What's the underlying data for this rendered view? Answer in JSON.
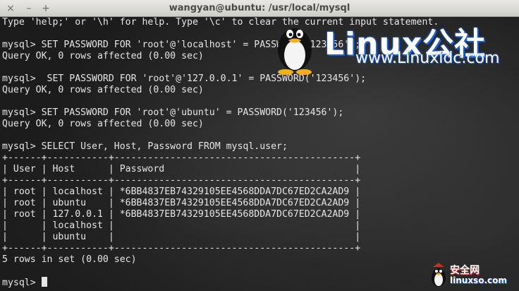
{
  "window": {
    "title": "wangyan@ubuntu: /usr/local/mysql",
    "close_glyph": "×",
    "minimize_glyph": "–",
    "maximize_glyph": "+"
  },
  "terminal": {
    "lines": [
      "Type 'help;' or '\\h' for help. Type '\\c' to clear the current input statement.",
      "",
      "mysql> SET PASSWORD FOR 'root'@'localhost' = PASSWORD('123456');",
      "Query OK, 0 rows affected (0.00 sec)",
      "",
      "mysql>  SET PASSWORD FOR 'root'@'127.0.0.1' = PASSWORD('123456');",
      "Query OK, 0 rows affected (0.00 sec)",
      "",
      "mysql> SET PASSWORD FOR 'root'@'ubuntu' = PASSWORD('123456');",
      "Query OK, 0 rows affected (0.00 sec)",
      "",
      "mysql> SELECT User, Host, Password FROM mysql.user;",
      "+------+-----------+-------------------------------------------+",
      "| User | Host      | Password                                  |",
      "+------+-----------+-------------------------------------------+",
      "| root | localhost | *6BB4837EB74329105EE4568DDA7DC67ED2CA2AD9 |",
      "| root | ubuntu    | *6BB4837EB74329105EE4568DDA7DC67ED2CA2AD9 |",
      "| root | 127.0.0.1 | *6BB4837EB74329105EE4568DDA7DC67ED2CA2AD9 |",
      "|      | localhost |                                           |",
      "|      | ubuntu    |                                           |",
      "+------+-----------+-------------------------------------------+",
      "5 rows in set (0.00 sec)",
      "",
      "mysql> "
    ]
  },
  "watermark": {
    "brand": "Linux公社",
    "url": "www.Linuxidc.com",
    "badge_cn": "安全网",
    "badge_url": "linuxso.com"
  }
}
